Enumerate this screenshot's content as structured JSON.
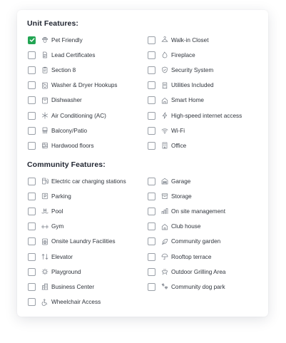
{
  "unit": {
    "title": "Unit Features:",
    "left": [
      {
        "label": "Pet Friendly",
        "icon": "paw-icon",
        "checked": true
      },
      {
        "label": "Lead Certificates",
        "icon": "document-icon",
        "checked": false
      },
      {
        "label": "Section 8",
        "icon": "clipboard-icon",
        "checked": false
      },
      {
        "label": "Washer & Dryer Hookups",
        "icon": "washer-icon",
        "checked": false
      },
      {
        "label": "Dishwasher",
        "icon": "dishwasher-icon",
        "checked": false
      },
      {
        "label": "Air Conditioning (AC)",
        "icon": "snowflake-icon",
        "checked": false
      },
      {
        "label": "Balcony/Patio",
        "icon": "balcony-icon",
        "checked": false
      },
      {
        "label": "Hardwood floors",
        "icon": "floor-icon",
        "checked": false
      }
    ],
    "right": [
      {
        "label": "Walk-in Closet",
        "icon": "hanger-icon",
        "checked": false
      },
      {
        "label": "Fireplace",
        "icon": "flame-icon",
        "checked": false
      },
      {
        "label": "Security System",
        "icon": "shield-icon",
        "checked": false
      },
      {
        "label": "Utilities Included",
        "icon": "bill-icon",
        "checked": false
      },
      {
        "label": "Smart Home",
        "icon": "smart-home-icon",
        "checked": false
      },
      {
        "label": "High-speed internet access",
        "icon": "lightning-icon",
        "checked": false
      },
      {
        "label": "Wi-Fi",
        "icon": "wifi-icon",
        "checked": false
      },
      {
        "label": "Office",
        "icon": "office-icon",
        "checked": false
      }
    ]
  },
  "community": {
    "title": "Community Features:",
    "left": [
      {
        "label": "Electric car charging stations",
        "icon": "ev-charger-icon",
        "checked": false
      },
      {
        "label": "Parking",
        "icon": "parking-icon",
        "checked": false
      },
      {
        "label": "Pool",
        "icon": "pool-icon",
        "checked": false
      },
      {
        "label": "Gym",
        "icon": "dumbbell-icon",
        "checked": false
      },
      {
        "label": "Onsite Laundry Facilities",
        "icon": "laundry-icon",
        "checked": false
      },
      {
        "label": "Elevator",
        "icon": "elevator-icon",
        "checked": false
      },
      {
        "label": "Playground",
        "icon": "playground-icon",
        "checked": false
      },
      {
        "label": "Business Center",
        "icon": "building-icon",
        "checked": false
      },
      {
        "label": "Wheelchair Access",
        "icon": "wheelchair-icon",
        "checked": false
      }
    ],
    "right": [
      {
        "label": "Garage",
        "icon": "garage-icon",
        "checked": false
      },
      {
        "label": "Storage",
        "icon": "storage-box-icon",
        "checked": false
      },
      {
        "label": "On site management",
        "icon": "management-icon",
        "checked": false
      },
      {
        "label": "Club house",
        "icon": "clubhouse-icon",
        "checked": false
      },
      {
        "label": "Community garden",
        "icon": "leaf-icon",
        "checked": false
      },
      {
        "label": "Rooftop terrace",
        "icon": "umbrella-icon",
        "checked": false
      },
      {
        "label": "Outdoor Grilling Area",
        "icon": "grill-icon",
        "checked": false
      },
      {
        "label": "Community dog park",
        "icon": "paw-prints-icon",
        "checked": false
      }
    ]
  },
  "colors": {
    "checked": "#22a553",
    "checkbox_border": "#9aa0a8",
    "text": "#2f343c",
    "icon": "#7d838c"
  }
}
